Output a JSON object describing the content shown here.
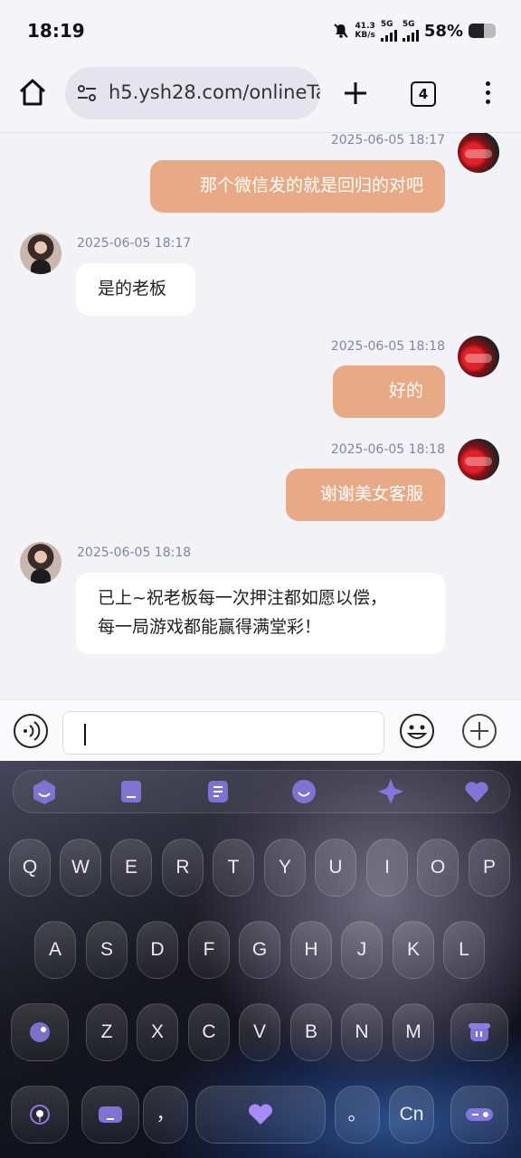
{
  "status": {
    "time": "18:19",
    "net_speed_value": "41.3",
    "net_speed_unit": "KB/s",
    "sim1": "5G",
    "sim2": "5G",
    "battery_text": "58%",
    "battery_level": 0.58
  },
  "browser": {
    "url": "h5.ysh28.com/onlineTa",
    "tab_count": "4"
  },
  "messages": [
    {
      "sender": "me",
      "timestamp": "2025-06-05 18:17",
      "text": "那个微信发的就是回归的对吧"
    },
    {
      "sender": "them",
      "timestamp": "2025-06-05 18:17",
      "text": "是的老板"
    },
    {
      "sender": "me",
      "timestamp": "2025-06-05 18:18",
      "text": "好的"
    },
    {
      "sender": "me",
      "timestamp": "2025-06-05 18:18",
      "text": "谢谢美女客服"
    },
    {
      "sender": "them",
      "timestamp": "2025-06-05 18:18",
      "text_line1": "已上~祝老板每一次押注都如愿以偿，",
      "text_line2": "每一局游戏都能赢得满堂彩！"
    }
  ],
  "composer": {
    "value": ""
  },
  "keyboard": {
    "row1": [
      "Q",
      "W",
      "E",
      "R",
      "T",
      "Y",
      "U",
      "I",
      "O",
      "P"
    ],
    "row2": [
      "A",
      "S",
      "D",
      "F",
      "G",
      "H",
      "J",
      "K",
      "L"
    ],
    "row3": [
      "Z",
      "X",
      "C",
      "V",
      "B",
      "N",
      "M"
    ],
    "comma": "，",
    "period": "。",
    "lang": "Cn",
    "toolbar_icons": [
      "toolbar-app-icon",
      "toolbar-clipboard-icon",
      "toolbar-text-icon",
      "toolbar-theme-icon",
      "toolbar-sparkle-icon",
      "toolbar-favorite-icon"
    ],
    "accent": "#8a7be8"
  }
}
